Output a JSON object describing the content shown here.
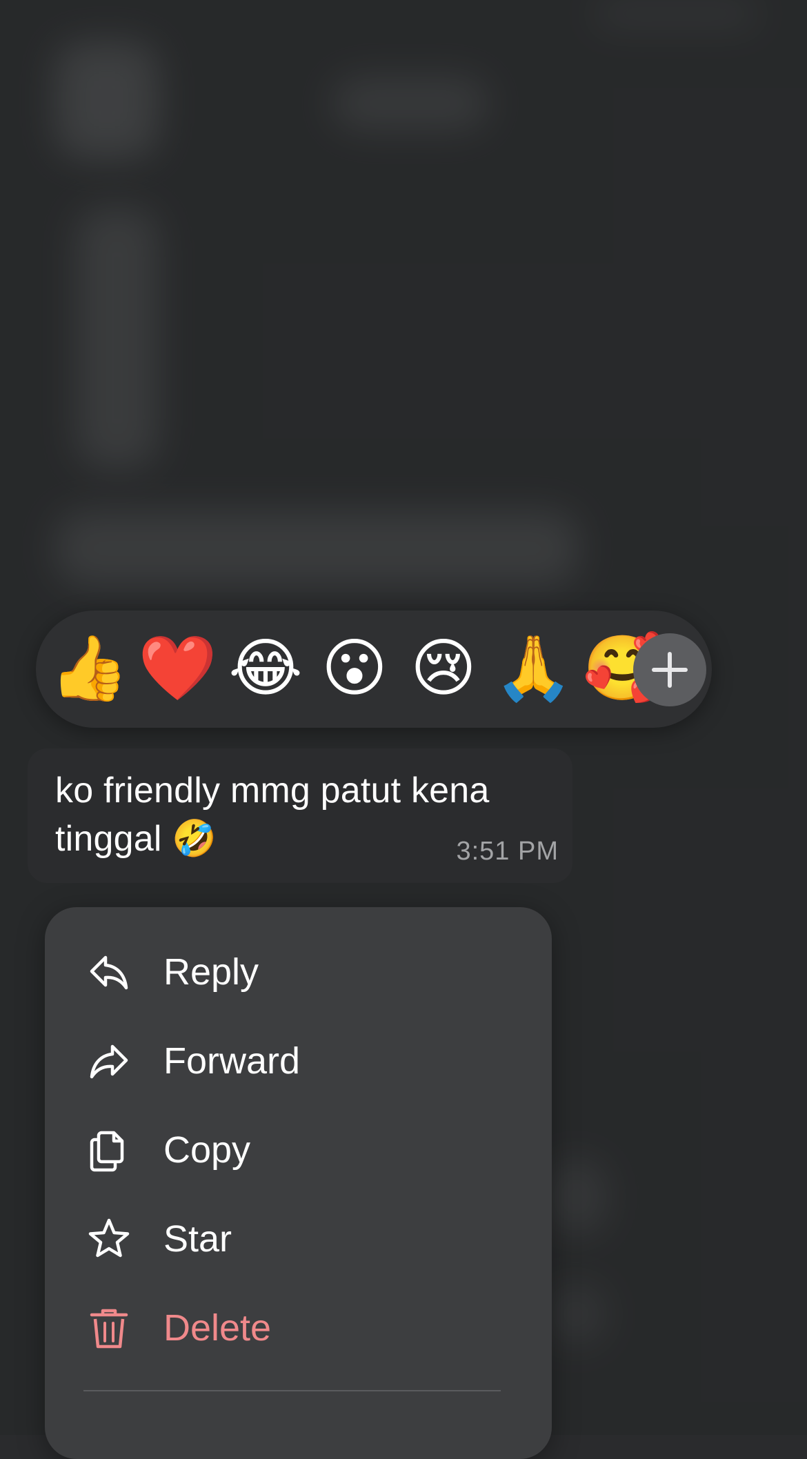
{
  "reactions": {
    "emojis": [
      "👍",
      "❤️",
      "😂",
      "😮",
      "😢",
      "🙏",
      "🥰"
    ],
    "more_icon": "plus-icon"
  },
  "message": {
    "text": "ko friendly mmg patut kena tinggal 🤣",
    "time": "3:51 PM"
  },
  "menu": {
    "items": [
      {
        "label": "Reply",
        "icon": "reply-icon"
      },
      {
        "label": "Forward",
        "icon": "forward-icon"
      },
      {
        "label": "Copy",
        "icon": "copy-icon"
      },
      {
        "label": "Star",
        "icon": "star-icon"
      },
      {
        "label": "Delete",
        "icon": "trash-icon",
        "color": "#f0898b"
      }
    ]
  },
  "colors": {
    "background": "#2a2b2d",
    "menu": "#3d3e40",
    "danger": "#f0898b"
  }
}
